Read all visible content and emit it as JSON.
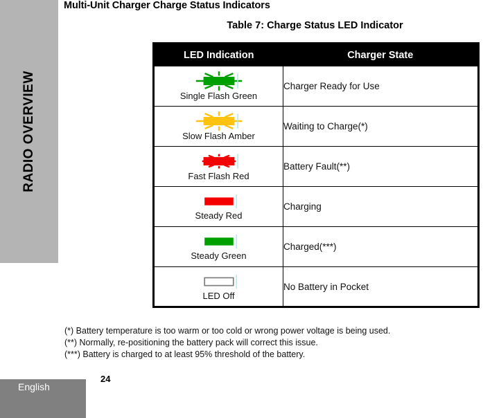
{
  "chapter_tab": {
    "label": "RADIO OVERVIEW"
  },
  "section": {
    "heading": "Multi-Unit Charger Charge Status Indicators"
  },
  "table": {
    "caption": "Table 7: Charge Status LED Indicator",
    "headers": {
      "led": "LED Indication",
      "state": "Charger State"
    },
    "rows": [
      {
        "icon": "flash-green-led-icon",
        "style": "flash",
        "color": "#00a000",
        "ray_len": "long",
        "led_label": "Single Flash Green",
        "state": "Charger Ready for Use"
      },
      {
        "icon": "flash-amber-led-icon",
        "style": "flash",
        "color": "#ffc20e",
        "ray_len": "long",
        "led_label": "Slow Flash Amber",
        "state": "Waiting to Charge(*)"
      },
      {
        "icon": "flash-red-led-icon",
        "style": "flash",
        "color": "#f40000",
        "ray_len": "short",
        "led_label": "Fast Flash Red",
        "state": "Battery Fault(**)"
      },
      {
        "icon": "steady-red-led-icon",
        "style": "steady",
        "color": "#f40000",
        "ray_len": "none",
        "led_label": "Steady Red",
        "state": "Charging"
      },
      {
        "icon": "steady-green-led-icon",
        "style": "steady",
        "color": "#00a000",
        "ray_len": "none",
        "led_label": "Steady Green",
        "state": "Charged(***)"
      },
      {
        "icon": "led-off-icon",
        "style": "off",
        "color": "#ffffff",
        "ray_len": "none",
        "led_label": "LED Off",
        "state": "No Battery in Pocket"
      }
    ]
  },
  "footnotes": [
    "(*) Battery temperature is too warm or too cold or wrong power voltage is being used.",
    "(**) Normally, re-positioning the battery pack will correct this issue.",
    "(***) Battery is charged to at least 95% threshold of the battery."
  ],
  "footer": {
    "language": "English",
    "page_number": "24"
  },
  "colors": {
    "chapter_tab_bg": "#b4b4b4",
    "footer_bg": "#808080",
    "header_bg": "#000000",
    "cyan_marker": "#a8e8f0",
    "led_off_outline": "#808080"
  }
}
